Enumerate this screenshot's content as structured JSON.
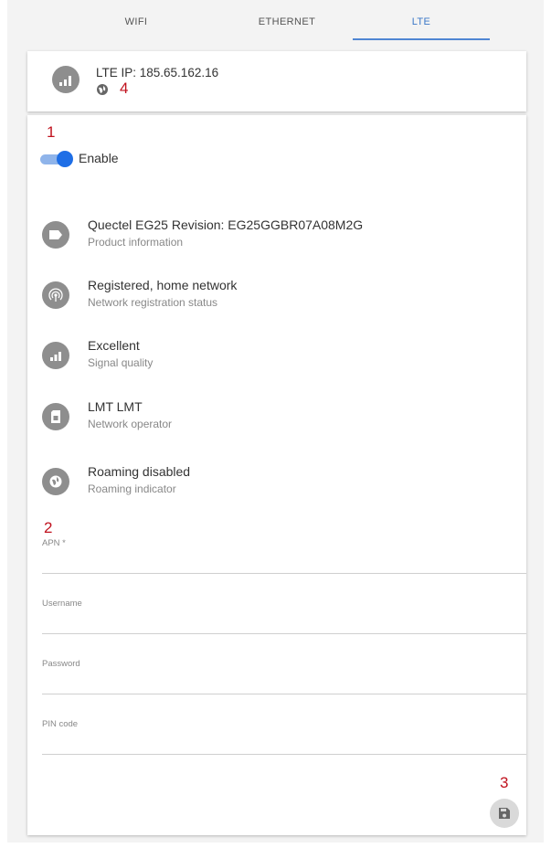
{
  "tabs": [
    {
      "label": "WIFI"
    },
    {
      "label": "ETHERNET"
    },
    {
      "label": "LTE"
    }
  ],
  "active_tab": "LTE",
  "accent_color": "#4f86d3",
  "annotation_color": "#c0121e",
  "header_card": {
    "ip_text": "LTE IP: 185.65.162.16",
    "icon": "signal-icon",
    "globe_icon": "globe-icon"
  },
  "annotations": {
    "n1": "1",
    "n2": "2",
    "n3": "3",
    "n4": "4"
  },
  "enable": {
    "label": "Enable",
    "state": true
  },
  "info_rows": [
    {
      "title": "Quectel EG25 Revision: EG25GGBR07A08M2G",
      "subtitle": "Product information",
      "icon": "label-icon"
    },
    {
      "title": "Registered, home network",
      "subtitle": "Network registration status",
      "icon": "antenna-icon"
    },
    {
      "title": "Excellent",
      "subtitle": "Signal quality",
      "icon": "signal-bars-icon"
    },
    {
      "title": "LMT LMT",
      "subtitle": "Network operator",
      "icon": "sim-card-icon"
    },
    {
      "title": "Roaming disabled",
      "subtitle": "Roaming indicator",
      "icon": "globe-icon"
    }
  ],
  "fields": [
    {
      "label": "APN *",
      "value": ""
    },
    {
      "label": "Username",
      "value": ""
    },
    {
      "label": "Password",
      "value": ""
    },
    {
      "label": "PIN code",
      "value": ""
    }
  ],
  "save_icon": "save-icon"
}
